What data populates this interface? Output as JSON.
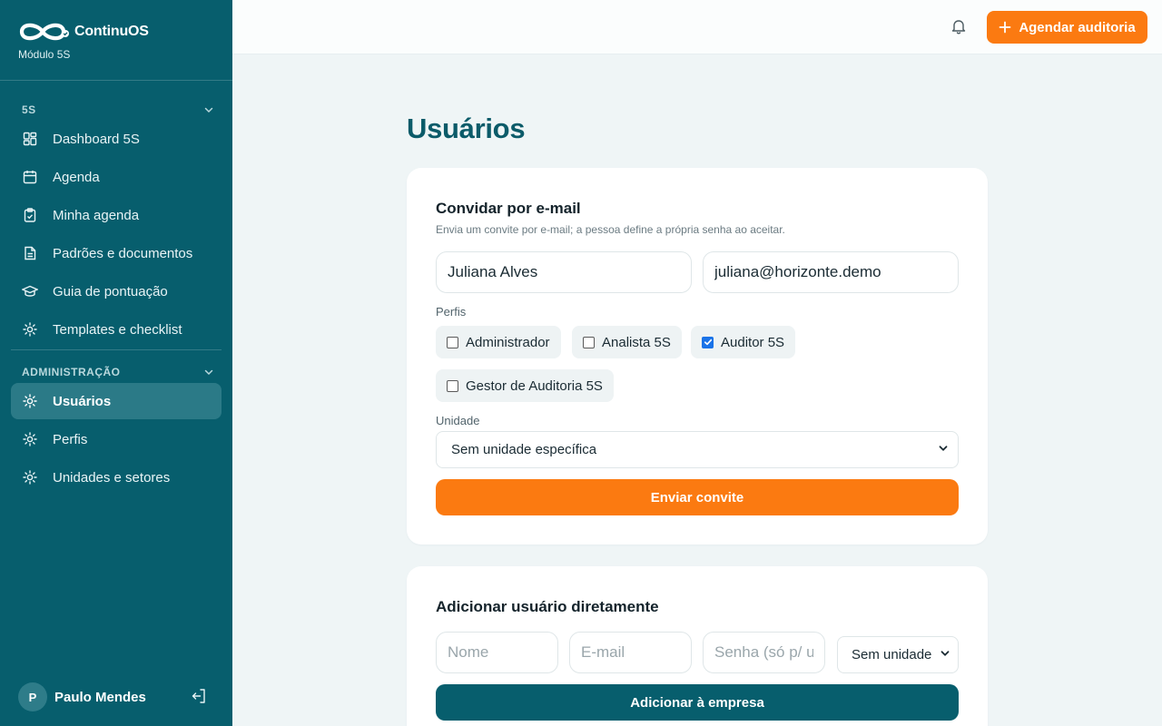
{
  "brand": {
    "name": "ContinuOS",
    "subtitle": "Módulo 5S"
  },
  "sidebar": {
    "sections": [
      {
        "label": "5S",
        "items": [
          {
            "label": "Dashboard 5S",
            "icon": "dashboard-icon"
          },
          {
            "label": "Agenda",
            "icon": "calendar-icon"
          },
          {
            "label": "Minha agenda",
            "icon": "clipboard-icon"
          },
          {
            "label": "Padrões e documentos",
            "icon": "document-icon"
          },
          {
            "label": "Guia de pontuação",
            "icon": "graduation-cap-icon"
          },
          {
            "label": "Templates e checklist",
            "icon": "gear-icon"
          }
        ]
      },
      {
        "label": "ADMINISTRAÇÃO",
        "items": [
          {
            "label": "Usuários",
            "icon": "gear-icon",
            "active": true
          },
          {
            "label": "Perfis",
            "icon": "gear-icon"
          },
          {
            "label": "Unidades e setores",
            "icon": "gear-icon"
          }
        ]
      }
    ],
    "user": {
      "initial": "P",
      "name": "Paulo Mendes"
    }
  },
  "topbar": {
    "cta_label": "Agendar auditoria"
  },
  "page": {
    "title": "Usuários"
  },
  "invite": {
    "title": "Convidar por e-mail",
    "description": "Envia um convite por e-mail; a pessoa define a própria senha ao aceitar.",
    "name_value": "Juliana Alves",
    "email_value": "juliana@horizonte.demo",
    "profiles_label": "Perfis",
    "profiles": [
      {
        "label": "Administrador",
        "checked": false
      },
      {
        "label": "Analista 5S",
        "checked": false
      },
      {
        "label": "Auditor 5S",
        "checked": true
      },
      {
        "label": "Gestor de Auditoria 5S",
        "checked": false
      }
    ],
    "unit_label": "Unidade",
    "unit_value": "Sem unidade específica",
    "submit_label": "Enviar convite"
  },
  "direct": {
    "title": "Adicionar usuário diretamente",
    "name_placeholder": "Nome",
    "email_placeholder": "E-mail",
    "password_placeholder": "Senha (só p/ u",
    "unit_value": "Sem unidade",
    "submit_label": "Adicionar à empresa"
  },
  "colors": {
    "sidebar": "#075e6d",
    "accent": "#fb7a11",
    "title": "#0b5b69",
    "active_item": "#2b7a87",
    "checkbox": "#1a73e8"
  }
}
